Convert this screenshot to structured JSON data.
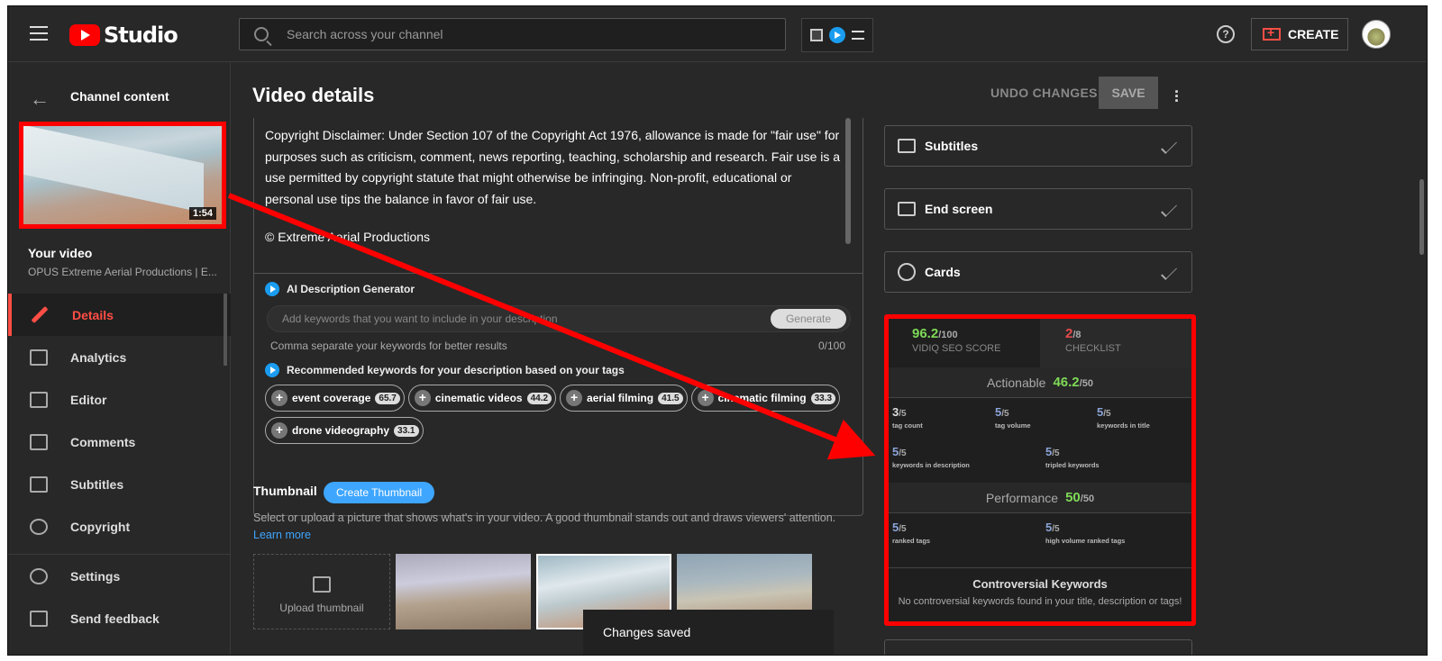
{
  "topbar": {
    "logo_text": "Studio",
    "search_placeholder": "Search across your channel",
    "create_label": "CREATE"
  },
  "sidebar": {
    "header": "Channel content",
    "thumbnail_duration": "1:54",
    "your_video_label": "Your video",
    "video_subtitle": "OPUS Extreme Aerial Productions | E...",
    "items": [
      {
        "label": "Details",
        "icon": "pencil-icon"
      },
      {
        "label": "Analytics",
        "icon": "analytics-icon"
      },
      {
        "label": "Editor",
        "icon": "editor-icon"
      },
      {
        "label": "Comments",
        "icon": "comments-icon"
      },
      {
        "label": "Subtitles",
        "icon": "subtitles-icon"
      },
      {
        "label": "Copyright",
        "icon": "copyright-icon"
      }
    ],
    "bottom_items": [
      {
        "label": "Settings",
        "icon": "gear-icon"
      },
      {
        "label": "Send feedback",
        "icon": "feedback-icon"
      }
    ]
  },
  "main": {
    "title": "Video details",
    "undo_label": "UNDO CHANGES",
    "save_label": "SAVE",
    "description_text": "Copyright Disclaimer: Under Section 107 of the Copyright Act 1976, allowance is made for \"fair use\" for purposes such as criticism, comment, news reporting, teaching, scholarship and research. Fair use is a use permitted by copyright statute that might otherwise be infringing. Non-profit, educational or personal use tips the balance in favor of fair use.",
    "description_copyright": "© Extreme Aerial Productions",
    "ai": {
      "title": "AI Description Generator",
      "placeholder": "Add keywords that you want to include in your description",
      "generate_label": "Generate",
      "hint": "Comma separate your keywords for better results",
      "count": "0/100"
    },
    "recommended_title": "Recommended keywords for your description based on your tags",
    "keywords": [
      {
        "label": "event coverage",
        "score": "65.7"
      },
      {
        "label": "cinematic videos",
        "score": "44.2"
      },
      {
        "label": "aerial filming",
        "score": "41.5"
      },
      {
        "label": "cinematic filming",
        "score": "33.3"
      },
      {
        "label": "drone videography",
        "score": "33.1"
      }
    ],
    "thumbnail": {
      "title": "Thumbnail",
      "create_label": "Create Thumbnail",
      "description": "Select or upload a picture that shows what's in your video. A good thumbnail stands out and draws viewers' attention.",
      "learn_more": "Learn more",
      "upload_label": "Upload thumbnail"
    },
    "toast": "Changes saved"
  },
  "right_cards": [
    {
      "label": "Subtitles",
      "icon": "subtitles-icon"
    },
    {
      "label": "End screen",
      "icon": "end-screen-icon"
    },
    {
      "label": "Cards",
      "icon": "info-icon"
    }
  ],
  "seo": {
    "score": "96.2",
    "score_den": "/100",
    "score_label": "VIDIQ SEO SCORE",
    "checklist": "2",
    "checklist_den": "/8",
    "checklist_label": "CHECKLIST",
    "actionable_label": "Actionable",
    "actionable_score": "46.2",
    "actionable_den": "/50",
    "metrics_actionable": [
      {
        "value": "3",
        "den": "/5",
        "label": "tag count"
      },
      {
        "value": "5",
        "den": "/5",
        "label": "tag volume"
      },
      {
        "value": "5",
        "den": "/5",
        "label": "keywords in title"
      },
      {
        "value": "5",
        "den": "/5",
        "label": "keywords in description"
      },
      {
        "value": "5",
        "den": "/5",
        "label": "tripled keywords"
      }
    ],
    "performance_label": "Performance",
    "performance_score": "50",
    "performance_den": "/50",
    "metrics_performance": [
      {
        "value": "5",
        "den": "/5",
        "label": "ranked tags"
      },
      {
        "value": "5",
        "den": "/5",
        "label": "high volume ranked tags"
      }
    ],
    "controversial_title": "Controversial Keywords",
    "controversial_text": "No controversial keywords found in your title, description or tags!"
  },
  "colors": {
    "accent_red": "#ff0000",
    "score_green": "#7ed957",
    "link_blue": "#3ea6ff"
  }
}
